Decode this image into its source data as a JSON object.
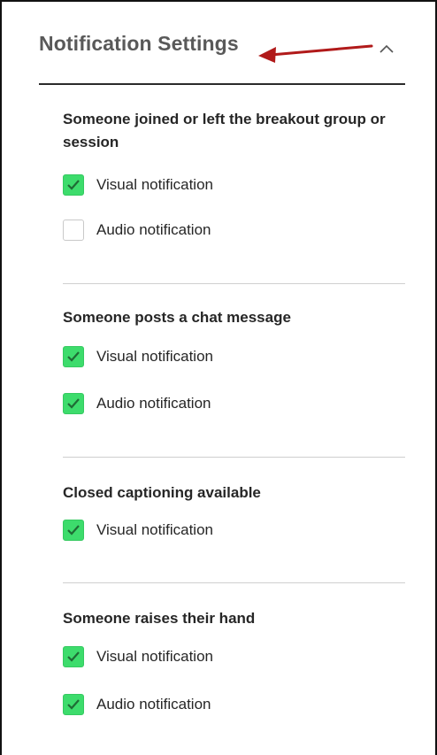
{
  "header": {
    "title": "Notification Settings",
    "collapse_icon": "chevron-up-icon",
    "annotation_arrow_color": "#b11a1a"
  },
  "colors": {
    "checked": "#3ddc6c",
    "checkmark": "#1f6b35"
  },
  "sections": [
    {
      "title": "Someone joined or left the breakout group or session",
      "options": [
        {
          "label": "Visual notification",
          "checked": true
        },
        {
          "label": "Audio notification",
          "checked": false
        }
      ]
    },
    {
      "title": "Someone posts a chat message",
      "options": [
        {
          "label": "Visual notification",
          "checked": true
        },
        {
          "label": "Audio notification",
          "checked": true
        }
      ]
    },
    {
      "title": "Closed captioning available",
      "options": [
        {
          "label": "Visual notification",
          "checked": true
        }
      ]
    },
    {
      "title": "Someone raises their hand",
      "options": [
        {
          "label": "Visual notification",
          "checked": true
        },
        {
          "label": "Audio notification",
          "checked": true
        }
      ]
    }
  ]
}
